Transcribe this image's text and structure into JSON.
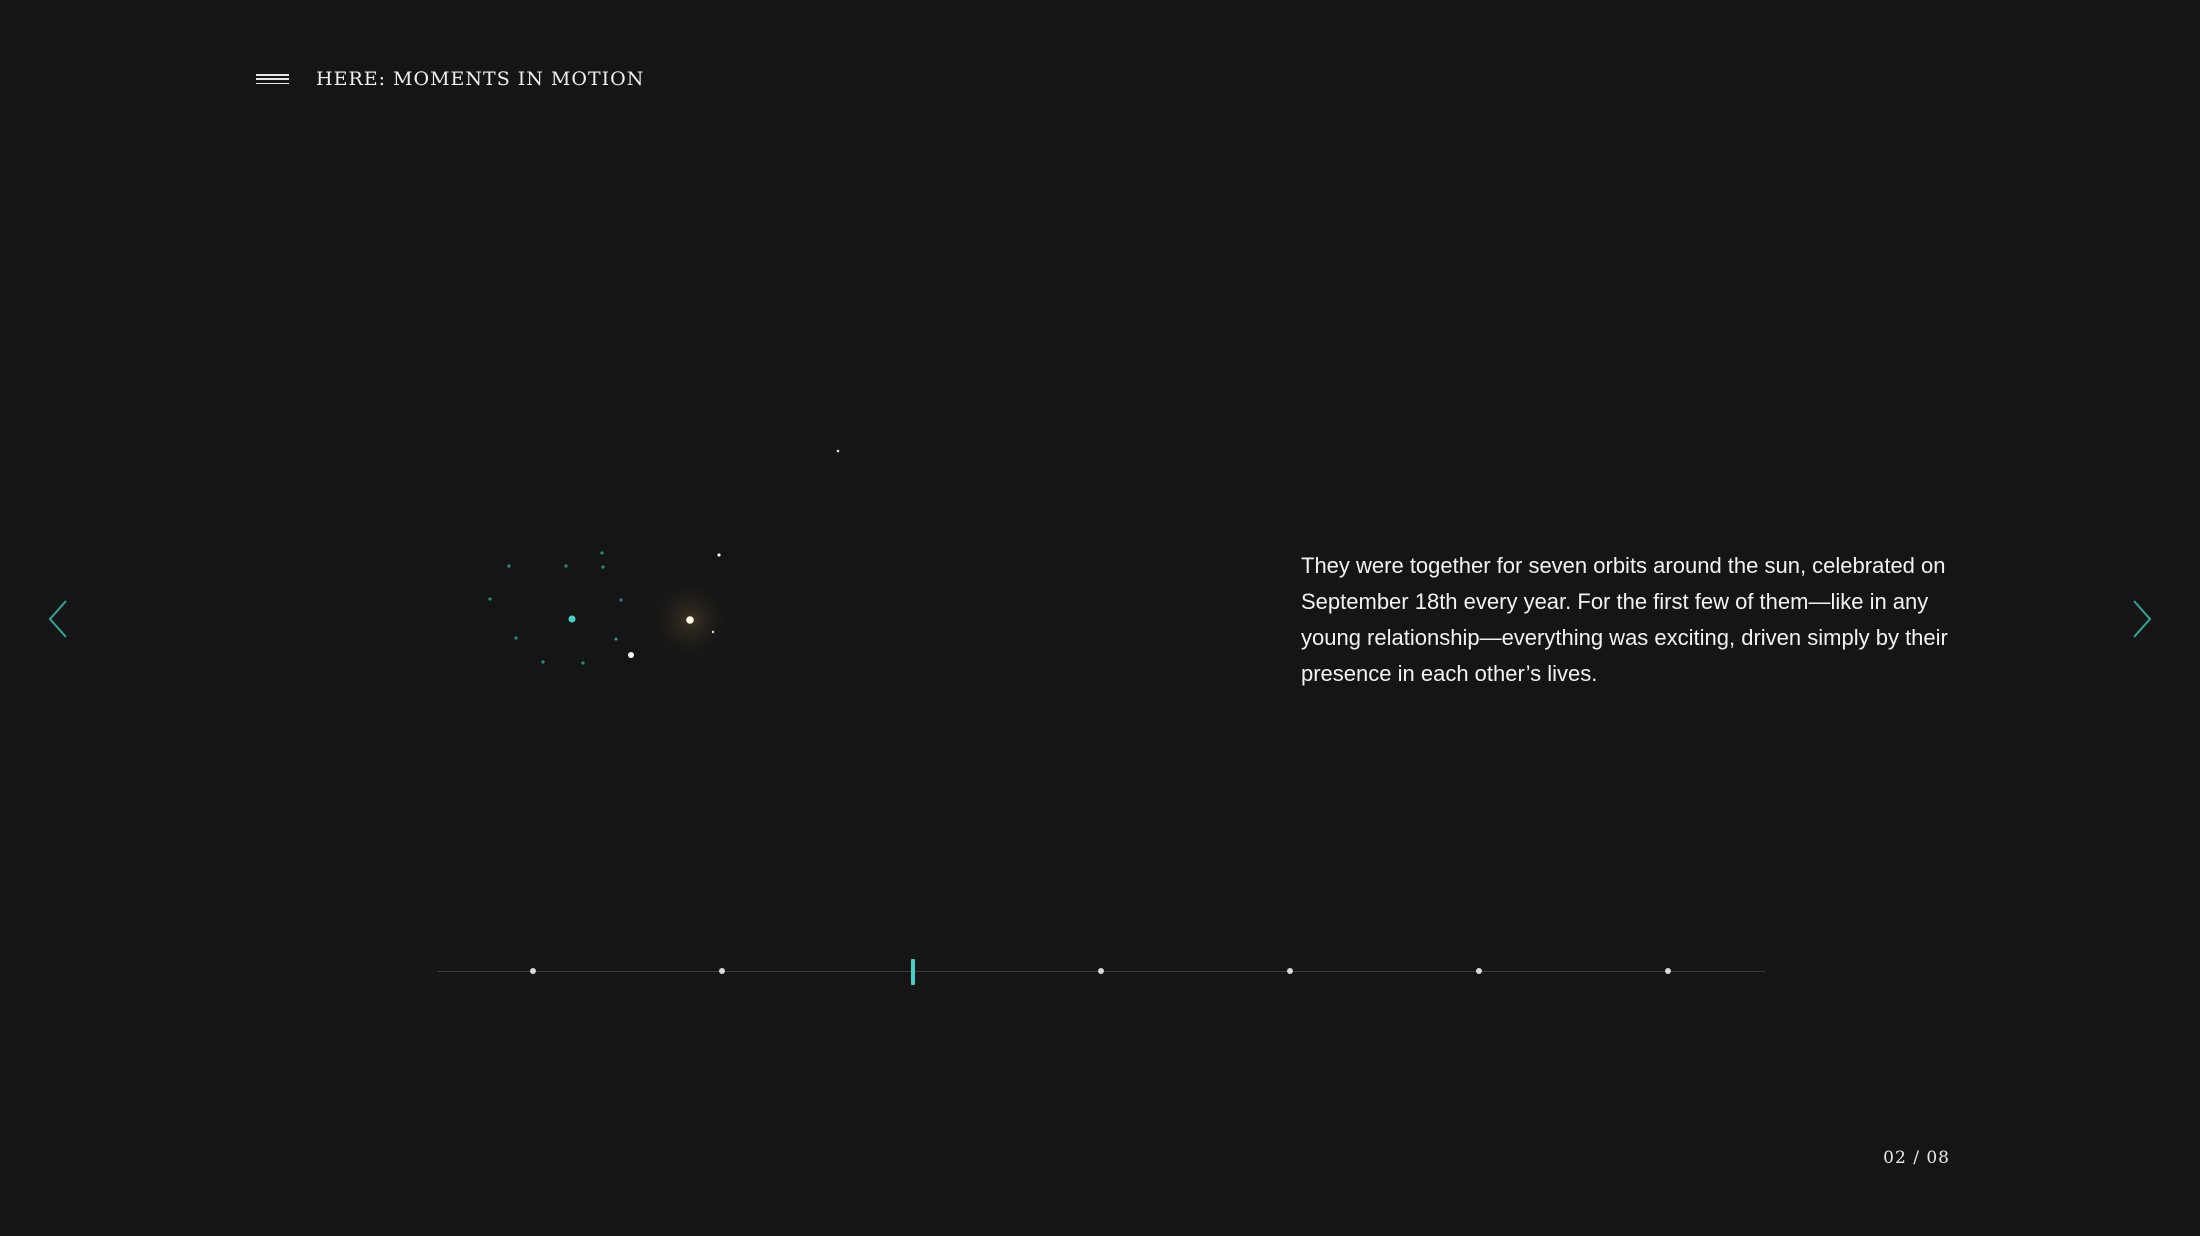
{
  "header": {
    "title": "HERE: MOMENTS IN MOTION",
    "menu_icon": "hamburger-menu-icon"
  },
  "navigation": {
    "prev_icon": "chevron-left-icon",
    "next_icon": "chevron-right-icon",
    "arrow_color": "#2fa69a"
  },
  "story": {
    "text": "They were together for seven orbits around the sun, celebrated on September 18th every year. For the first few of them—like in any young relationship—everything was exciting, driven simply by their presence in each other’s lives."
  },
  "timeline": {
    "total_steps": 8,
    "active_index": 2,
    "accent_color": "#43d3c6"
  },
  "pagination": {
    "current": "02",
    "separator": "/",
    "total": "08"
  },
  "colors": {
    "background": "#151515",
    "accent": "#43d3c6",
    "text": "#f2f2f2"
  }
}
